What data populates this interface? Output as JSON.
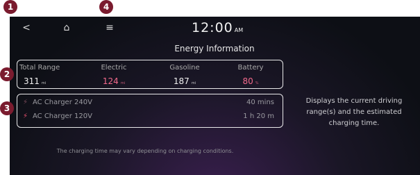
{
  "callouts": {
    "back": "1",
    "menu": "4",
    "range": "2",
    "charging": "3"
  },
  "topbar": {
    "back_icon": "<",
    "home_icon": "⌂",
    "menu_icon": "≡",
    "time": "12:00",
    "ampm": "AM"
  },
  "title": "Energy Information",
  "range": {
    "columns": [
      {
        "label": "Total Range",
        "value": "311",
        "unit": "mi"
      },
      {
        "label": "Electric",
        "value": "124",
        "unit": "mi"
      },
      {
        "label": "Gasoline",
        "value": "187",
        "unit": "mi"
      },
      {
        "label": "Battery",
        "value": "80",
        "unit": "%"
      }
    ]
  },
  "charging": {
    "rows": [
      {
        "name": "AC Charger 240V",
        "time": "40 mins"
      },
      {
        "name": "AC Charger 120V",
        "time": "1 h  20 m"
      }
    ]
  },
  "note": "The charging time may vary depending on charging conditions.",
  "description": "Displays the current driving range(s) and the estimated charging time.",
  "colors": {
    "accent": "#f26a8c",
    "callout": "#7a1b2e",
    "border": "#e9e9ea"
  }
}
